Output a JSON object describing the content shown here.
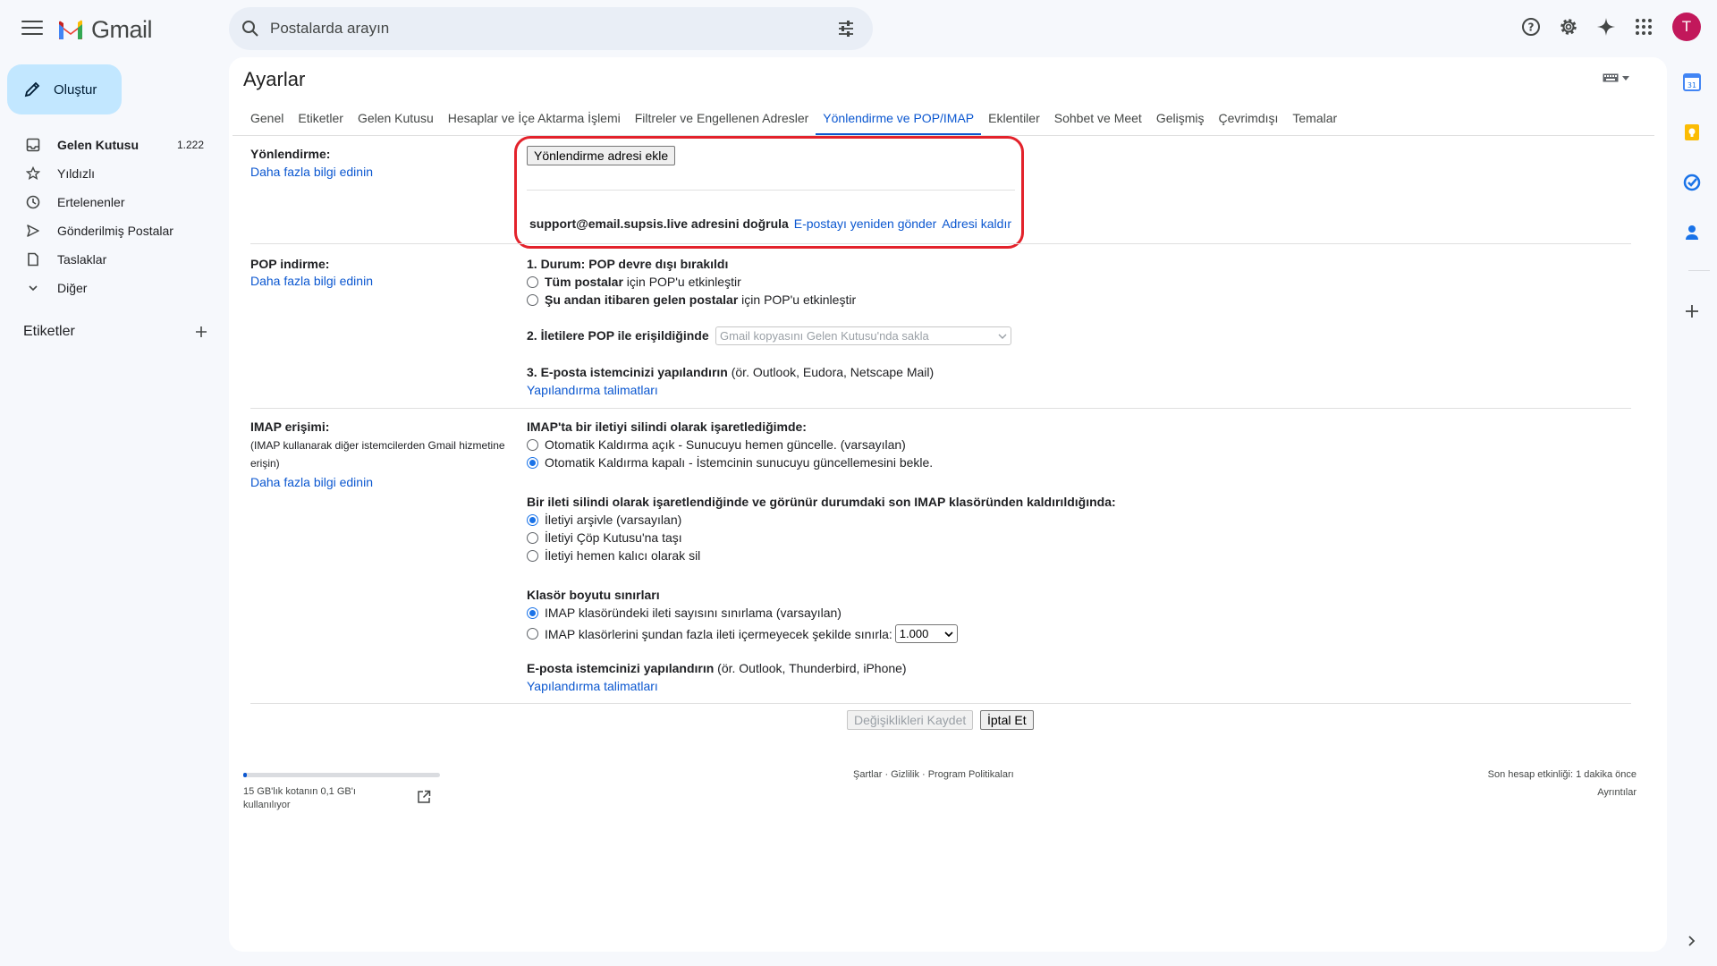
{
  "app": {
    "name": "Gmail",
    "avatar_letter": "T"
  },
  "search": {
    "placeholder": "Postalarda arayın"
  },
  "compose_label": "Oluştur",
  "sidebar": {
    "items": [
      {
        "label": "Gelen Kutusu",
        "count": "1.222",
        "icon": "inbox-icon"
      },
      {
        "label": "Yıldızlı",
        "icon": "star-icon"
      },
      {
        "label": "Ertelenenler",
        "icon": "clock-icon"
      },
      {
        "label": "Gönderilmiş Postalar",
        "icon": "send-icon"
      },
      {
        "label": "Taslaklar",
        "icon": "draft-icon"
      },
      {
        "label": "Diğer",
        "icon": "chevron-down-icon"
      }
    ],
    "labels_title": "Etiketler"
  },
  "settings": {
    "title": "Ayarlar",
    "tabs": [
      "Genel",
      "Etiketler",
      "Gelen Kutusu",
      "Hesaplar ve İçe Aktarma İşlemi",
      "Filtreler ve Engellenen Adresler",
      "Yönlendirme ve POP/IMAP",
      "Eklentiler",
      "Sohbet ve Meet",
      "Gelişmiş",
      "Çevrimdışı",
      "Temalar"
    ],
    "more_info": "Daha fazla bilgi edinin",
    "forwarding": {
      "label": "Yönlendirme:",
      "add_button": "Yönlendirme adresi ekle",
      "verify_text": "support@email.supsis.live adresini doğrula",
      "resend_link": "E-postayı yeniden gönder",
      "remove_link": "Adresi kaldır"
    },
    "pop": {
      "label": "POP indirme:",
      "status": "1. Durum: POP devre dışı bırakıldı",
      "opt1_bold": "Tüm postalar",
      "opt1_rest": " için POP'u etkinleştir",
      "opt2_bold": "Şu andan itibaren gelen postalar",
      "opt2_rest": " için POP'u etkinleştir",
      "access_label": "2. İletilere POP ile erişildiğinde",
      "access_select": "Gmail kopyasını Gelen Kutusu'nda sakla",
      "config_bold": "3. E-posta istemcinizi yapılandırın",
      "config_rest": " (ör. Outlook, Eudora, Netscape Mail)",
      "config_link": "Yapılandırma talimatları"
    },
    "imap": {
      "label": "IMAP erişimi:",
      "sub": "(IMAP kullanarak diğer istemcilerden Gmail hizmetine erişin)",
      "deleted_title": "IMAP'ta bir iletiyi silindi olarak işaretlediğimde:",
      "deleted_opts": [
        "Otomatik Kaldırma açık - Sunucuyu hemen güncelle. (varsayılan)",
        "Otomatik Kaldırma kapalı - İstemcinin sunucuyu güncellemesini bekle."
      ],
      "expunge_title": "Bir ileti silindi olarak işaretlendiğinde ve görünür durumdaki son IMAP klasöründen kaldırıldığında:",
      "expunge_opts": [
        "İletiyi arşivle (varsayılan)",
        "İletiyi Çöp Kutusu'na taşı",
        "İletiyi hemen kalıcı olarak sil"
      ],
      "folder_title": "Klasör boyutu sınırları",
      "folder_opt1": "IMAP klasöründeki ileti sayısını sınırlama (varsayılan)",
      "folder_opt2": "IMAP klasörlerini şundan fazla ileti içermeyecek şekilde sınırla:",
      "folder_select": "1.000",
      "config_bold": "E-posta istemcinizi yapılandırın",
      "config_rest": " (ör. Outlook, Thunderbird, iPhone)",
      "config_link": "Yapılandırma talimatları"
    },
    "save_button": "Değişiklikleri Kaydet",
    "cancel_button": "İptal Et"
  },
  "footer": {
    "quota_line1": "15 GB'lık kotanın 0,1 GB'ı",
    "quota_line2": "kullanılıyor",
    "quota_used_fraction": 0.007,
    "links": "Şartlar · Gizlilik · Program Politikaları",
    "activity": "Son hesap etkinliği: 1 dakika önce",
    "details": "Ayrıntılar"
  }
}
